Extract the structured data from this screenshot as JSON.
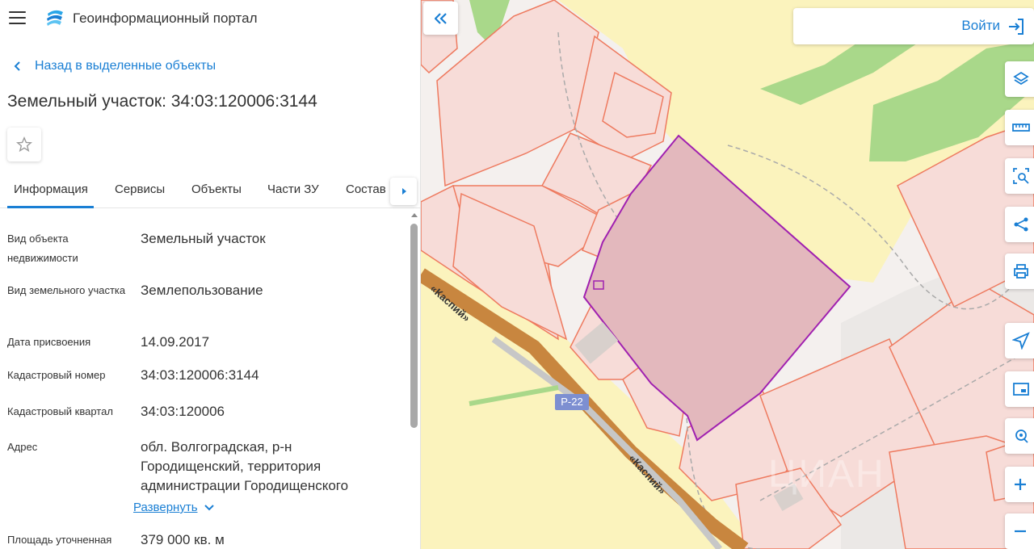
{
  "header": {
    "app_title": "Геоинформационный портал",
    "menu_icon": "hamburger-menu-icon",
    "logo_icon": "portal-logo-icon"
  },
  "back_link": "Назад в выделенные объекты",
  "object_title": "Земельный участок: 34:03:120006:3144",
  "tabs": [
    {
      "label": "Информация",
      "active": true
    },
    {
      "label": "Сервисы",
      "active": false
    },
    {
      "label": "Объекты",
      "active": false
    },
    {
      "label": "Части ЗУ",
      "active": false
    },
    {
      "label": "Состав",
      "active": false
    }
  ],
  "properties": [
    {
      "label": "Вид объекта недвижимости",
      "value": "Земельный участок"
    },
    {
      "label": "Вид земельного участка",
      "value": "Землепользование"
    },
    {
      "label": "Дата присвоения",
      "value": "14.09.2017"
    },
    {
      "label": "Кадастровый номер",
      "value": "34:03:120006:3144"
    },
    {
      "label": "Кадастровый квартал",
      "value": "34:03:120006"
    },
    {
      "label": "Адрес",
      "value": "обл. Волгоградская, р-н Городищенский, территория администрации Городищенского"
    },
    {
      "label": "Площадь уточненная",
      "value": "379 000 кв. м"
    }
  ],
  "expand_link": "Развернуть",
  "map": {
    "login_label": "Войти",
    "road_name": "«Каспий»",
    "route_number": "Р-22",
    "watermark": "ЦИАН",
    "colors": {
      "parcel_fill": "#f7dcd8",
      "parcel_stroke": "#ee7a5f",
      "selected_fill": "#e3b8bd",
      "selected_stroke": "#a020b0",
      "field": "#fbf3bd",
      "forest": "#a9d88a",
      "road": "#c8863f",
      "accent": "#1a7fd4"
    },
    "tools": [
      "layers-icon",
      "ruler-icon",
      "area-search-icon",
      "share-icon",
      "print-icon",
      "navigate-icon",
      "minimap-icon",
      "geolocation-icon",
      "zoom-in-icon",
      "zoom-out-icon"
    ]
  }
}
